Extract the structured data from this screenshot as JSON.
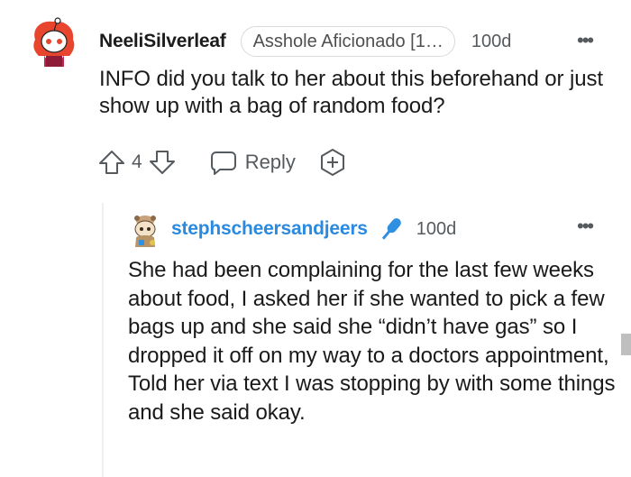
{
  "comment": {
    "username": "NeeliSilverleaf",
    "flair": "Asshole Aficionado [1…",
    "age": "100d",
    "more": "•••",
    "text": "INFO did you talk to her about this beforehand or just show up with a bag of random food?",
    "score": "4",
    "reply_label": "Reply",
    "icons": {
      "avatar": "snoo-avatar-red-hair",
      "upvote": "arrow-up-icon",
      "downvote": "arrow-down-icon",
      "reply": "chat-bubble-icon",
      "award": "add-award-icon"
    }
  },
  "reply": {
    "username": "stephscheersandjeers",
    "age": "100d",
    "more": "•••",
    "text": "She had been complaining for the last few weeks about food, I asked her if she wanted to pick a few bags up and she said she “didn’t have gas” so I dropped it off on my way to a doctors appointment, Told her via text I was stopping by with some things and she said okay.",
    "icons": {
      "avatar": "snoo-avatar-tan",
      "badge": "microphone-icon"
    }
  },
  "colors": {
    "reply_username": "#2a8adf",
    "meta_gray": "#555a5e",
    "text": "#1a1a1b",
    "flair_border": "#d7dadc",
    "mic_blue": "#2f8fe0"
  }
}
